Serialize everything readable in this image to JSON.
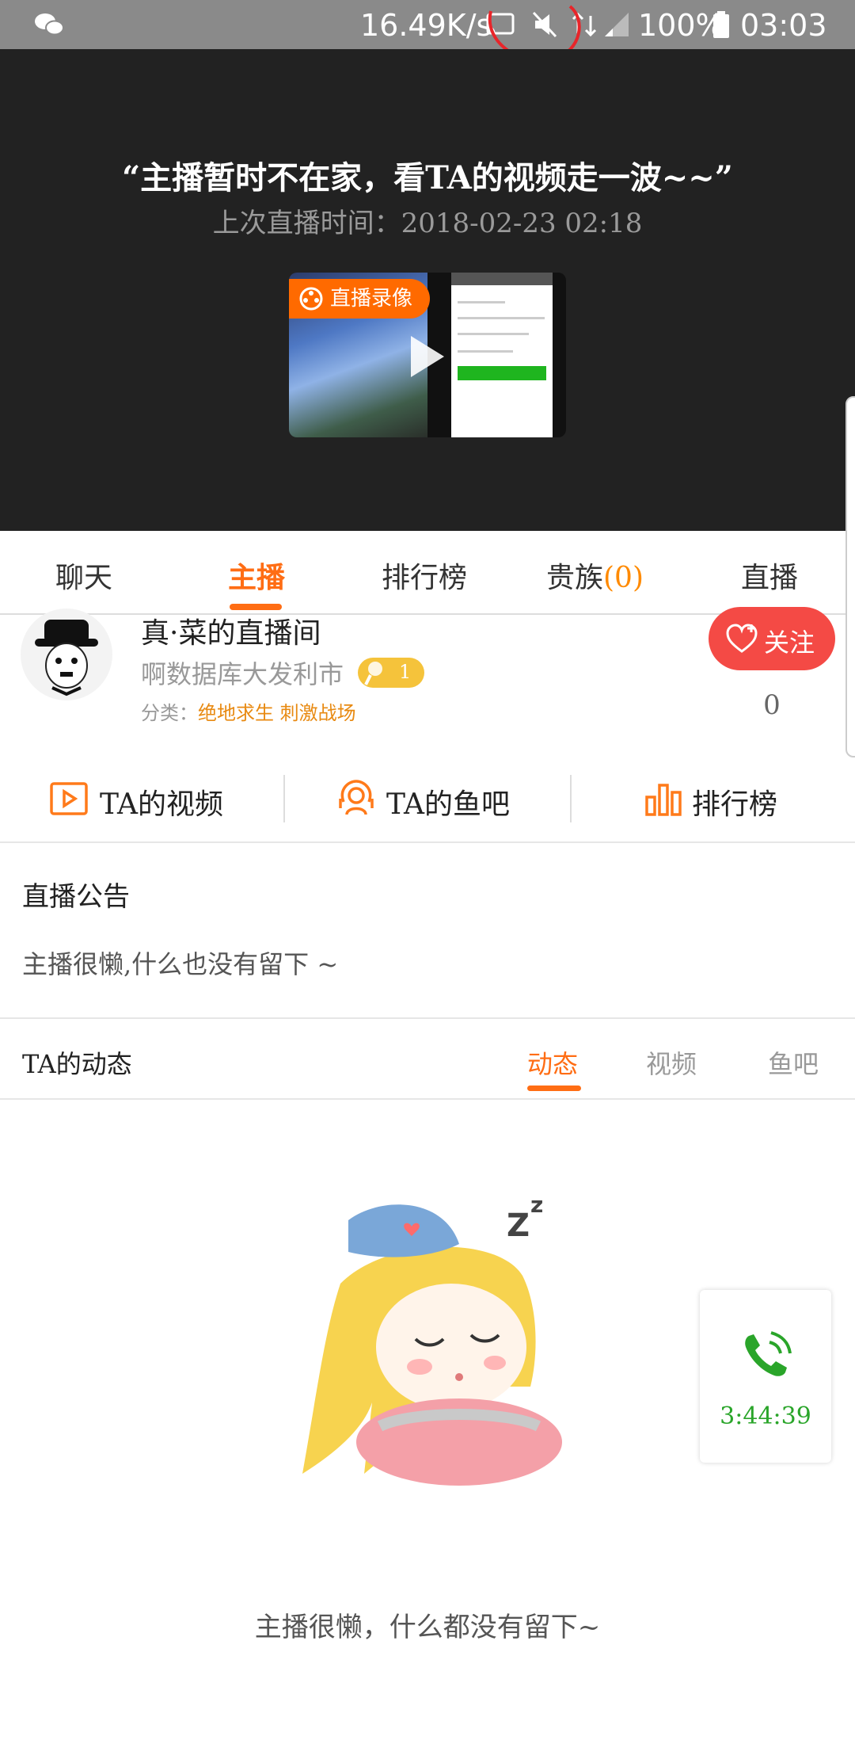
{
  "status_bar": {
    "net_speed": "16.49K/s",
    "battery": "100%",
    "time": "03:03"
  },
  "player": {
    "slogan": "“主播暂时不在家，看TA的视频走一波~~”",
    "last_live": "上次直播时间：2018-02-23   02:18",
    "recording_badge": "直播录像"
  },
  "tabs": {
    "chat": "聊天",
    "anchor": "主播",
    "rank": "排行榜",
    "nobles": "贵族",
    "nobles_count": "(0)",
    "live": "直播"
  },
  "anchor": {
    "room_name": "真·菜的直播间",
    "nickname": "啊数据库大发利市",
    "level": "1",
    "category_label": "分类：",
    "category_value": "绝地求生 刺激战场",
    "follow_label": "关注",
    "follow_count": "0"
  },
  "actions": {
    "videos": "TA的视频",
    "fishbar": "TA的鱼吧",
    "rank": "排行榜"
  },
  "announcement": {
    "title": "直播公告",
    "text": "主播很懒,什么也没有留下 ~"
  },
  "dynamics": {
    "title": "TA的动态",
    "tabs": [
      "动态",
      "视频",
      "鱼吧"
    ],
    "empty_text": "主播很懒，什么都没有留下~"
  },
  "call_widget": {
    "duration": "3:44:39"
  },
  "colors": {
    "accent": "#ff6d14",
    "follow": "#f44a45",
    "call_green": "#2aa52a"
  }
}
